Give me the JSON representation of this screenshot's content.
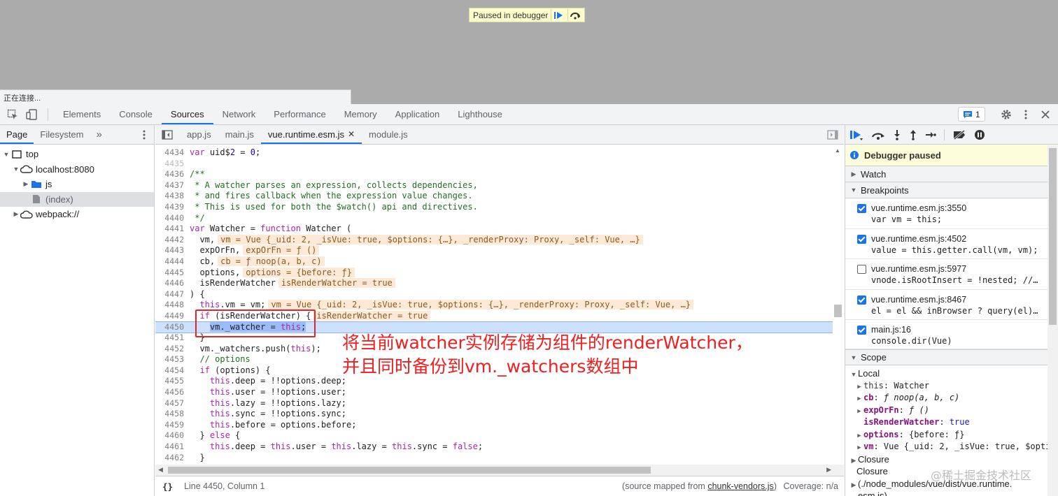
{
  "viewport": {
    "paused_text": "Paused in debugger",
    "connecting_text": "正在连接..."
  },
  "main_tabs": [
    "Elements",
    "Console",
    "Sources",
    "Network",
    "Performance",
    "Memory",
    "Application",
    "Lighthouse"
  ],
  "active_main_tab": "Sources",
  "issues_count": "1",
  "navigator": {
    "tabs": [
      "Page",
      "Filesystem"
    ],
    "more": "»",
    "tree": {
      "top": "top",
      "host": "localhost:8080",
      "js": "js",
      "index": "(index)",
      "webpack": "webpack://"
    }
  },
  "editor": {
    "tabs": [
      "app.js",
      "main.js",
      "vue.runtime.esm.js",
      "module.js"
    ],
    "active_tab": "vue.runtime.esm.js",
    "lines": [
      {
        "n": "4434",
        "text": "var uid$2 = 0;"
      },
      {
        "n": "4435",
        "text": ""
      },
      {
        "n": "4436",
        "text": "/**"
      },
      {
        "n": "4437",
        "text": " * A watcher parses an expression, collects dependencies,"
      },
      {
        "n": "4438",
        "text": " * and fires callback when the expression value changes."
      },
      {
        "n": "4439",
        "text": " * This is used for both the $watch() api and directives."
      },
      {
        "n": "4440",
        "text": " */"
      },
      {
        "n": "4441",
        "text": "var Watcher = function Watcher ("
      },
      {
        "n": "4442",
        "text": "  vm,",
        "inline": "vm = Vue {_uid: 2, _isVue: true, $options: {…}, _renderProxy: Proxy, _self: Vue, …}"
      },
      {
        "n": "4443",
        "text": "  expOrFn,",
        "inline": "expOrFn = ƒ ()"
      },
      {
        "n": "4444",
        "text": "  cb,",
        "inline": "cb = ƒ noop(a, b, c)"
      },
      {
        "n": "4445",
        "text": "  options,",
        "inline": "options = {before: ƒ}"
      },
      {
        "n": "4446",
        "text": "  isRenderWatcher",
        "inline": "isRenderWatcher = true"
      },
      {
        "n": "4447",
        "text": ") {"
      },
      {
        "n": "4448",
        "text": "  this.vm = vm;",
        "inline": "vm = Vue {_uid: 2, _isVue: true, $options: {…}, _renderProxy: Proxy, _self: Vue, …}"
      },
      {
        "n": "4449",
        "text": "  if (isRenderWatcher) {",
        "inline": "isRenderWatcher = true"
      },
      {
        "n": "4450",
        "text": "    vm._watcher = this;"
      },
      {
        "n": "4451",
        "text": "  }"
      },
      {
        "n": "4452",
        "text": "  vm._watchers.push(this);"
      },
      {
        "n": "4453",
        "text": "  // options"
      },
      {
        "n": "4454",
        "text": "  if (options) {"
      },
      {
        "n": "4455",
        "text": "    this.deep = !!options.deep;"
      },
      {
        "n": "4456",
        "text": "    this.user = !!options.user;"
      },
      {
        "n": "4457",
        "text": "    this.lazy = !!options.lazy;"
      },
      {
        "n": "4458",
        "text": "    this.sync = !!options.sync;"
      },
      {
        "n": "4459",
        "text": "    this.before = options.before;"
      },
      {
        "n": "4460",
        "text": "  } else {"
      },
      {
        "n": "4461",
        "text": "    this.deep = this.user = this.lazy = this.sync = false;"
      },
      {
        "n": "4462",
        "text": "  }"
      }
    ],
    "exec_line": "4450"
  },
  "annotation": {
    "line1": "将当前watcher实例存储为组件的renderWatcher，",
    "line2": "并且同时备份到vm._watchers数组中"
  },
  "status": {
    "braces": "{}",
    "position": "Line 4450, Column 1",
    "source_prefix": "(source mapped from ",
    "source_link": "chunk-vendors.js",
    "source_suffix": ")",
    "coverage": "Coverage: n/a"
  },
  "debugger": {
    "paused_message": "Debugger paused",
    "watch_label": "Watch",
    "breakpoints_label": "Breakpoints",
    "breakpoints": [
      {
        "file": "vue.runtime.esm.js:3550",
        "code": "var vm = this;",
        "checked": true
      },
      {
        "file": "vue.runtime.esm.js:4502",
        "code": "value = this.getter.call(vm, vm);",
        "checked": true
      },
      {
        "file": "vue.runtime.esm.js:5977",
        "code": "vnode.isRootInsert = !nested; //…",
        "checked": false
      },
      {
        "file": "vue.runtime.esm.js:8467",
        "code": "el = el && inBrowser ? query(el)…",
        "checked": true
      },
      {
        "file": "main.js:16",
        "code": "console.dir(Vue)",
        "checked": true
      }
    ],
    "scope_label": "Scope",
    "local_label": "Local",
    "scope_items": {
      "this_name": "this",
      "this_val": "Watcher",
      "cb_name": "cb",
      "cb_val": "ƒ noop(a, b, c)",
      "exp_name": "expOrFn",
      "exp_val": "ƒ ()",
      "irw_name": "isRenderWatcher",
      "irw_val": "true",
      "opt_name": "options",
      "opt_val": "{before: ƒ}",
      "vm_name": "vm",
      "vm_val": "Vue {_uid: 2, _isVue: true, $opti"
    },
    "closure_label": "Closure",
    "closure2_label": "Closure",
    "closure_path": "(./node_modules/vue/dist/vue.runtime.",
    "closure_path2": "esm.js)"
  },
  "watermark": "@稀土掘金技术社区",
  "colors": {
    "accent": "#1a73e8",
    "annotation": "#ee2020",
    "paused_bg": "#fefdd9"
  }
}
